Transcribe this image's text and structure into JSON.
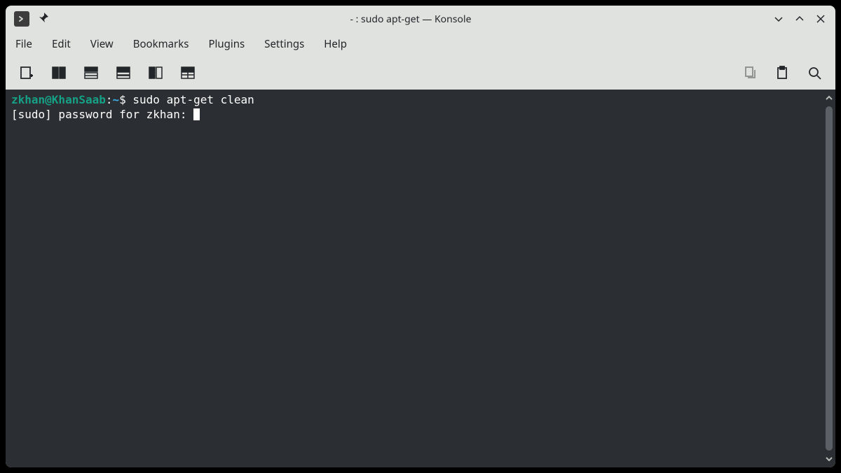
{
  "titlebar": {
    "title": "- : sudo apt-get — Konsole"
  },
  "menu": {
    "items": [
      "File",
      "Edit",
      "View",
      "Bookmarks",
      "Plugins",
      "Settings",
      "Help"
    ]
  },
  "toolbar": {
    "newtab": "new-tab",
    "split_lr": "split-left-right",
    "layout_a": "layout-a",
    "layout_b": "layout-b",
    "layout_c": "layout-c",
    "layout_d": "layout-d",
    "copy": "copy",
    "paste": "paste",
    "find": "find"
  },
  "terminal": {
    "prompt_user": "zkhan@KhanSaab",
    "prompt_colon": ":",
    "prompt_path": "~",
    "prompt_dollar": "$ ",
    "command": "sudo apt-get clean",
    "line2": "[sudo] password for zkhan: "
  }
}
